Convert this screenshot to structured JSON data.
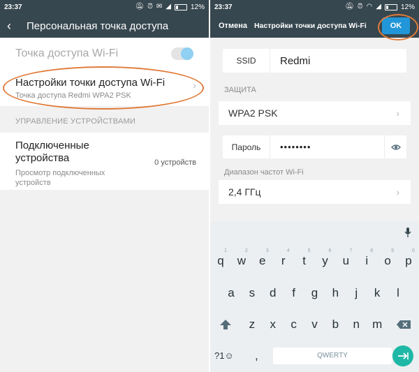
{
  "left": {
    "status": {
      "time": "23:37",
      "battery": "12%"
    },
    "title": "Персональная точка доступа",
    "wifi_toggle": {
      "label": "Точка доступа Wi-Fi",
      "state": "on"
    },
    "settings_item": {
      "title": "Настройки точки доступа Wi-Fi",
      "subtitle": "Точка доступа Redmi WPA2 PSK"
    },
    "section_header": "УПРАВЛЕНИЕ УСТРОЙСТВАМИ",
    "devices_item": {
      "title": "Подключенные устройства",
      "subtitle": "Просмотр подключенных устройств",
      "value": "0 устройств"
    }
  },
  "right": {
    "status": {
      "time": "23:37",
      "battery": "12%"
    },
    "cancel_label": "Отмена",
    "title": "Настройки точки доступа Wi-Fi",
    "ok_label": "OK",
    "ssid": {
      "label": "SSID",
      "value": "Redmi"
    },
    "security_caption": "ЗАЩИТА",
    "security_value": "WPA2 PSK",
    "password": {
      "label": "Пароль",
      "value": "••••••••"
    },
    "band_caption": "Диапазон частот Wi-Fi",
    "band_value": "2,4 ГГц",
    "keyboard": {
      "row1": [
        "q",
        "w",
        "e",
        "r",
        "t",
        "y",
        "u",
        "i",
        "o",
        "p"
      ],
      "row1_hints": [
        "1",
        "2",
        "3",
        "4",
        "5",
        "6",
        "7",
        "8",
        "9",
        "0"
      ],
      "row2": [
        "a",
        "s",
        "d",
        "f",
        "g",
        "h",
        "j",
        "k",
        "l"
      ],
      "row3": [
        "z",
        "x",
        "c",
        "v",
        "b",
        "n",
        "m"
      ],
      "symbols_label": "?1☺",
      "comma": ",",
      "space_label": "QWERTY",
      "period": "."
    }
  },
  "colors": {
    "bar": "#37474f",
    "accent": "#2196d8",
    "highlight": "#e07b39",
    "enter": "#1fb8a6",
    "toggle_knob": "#8fd0f3"
  }
}
